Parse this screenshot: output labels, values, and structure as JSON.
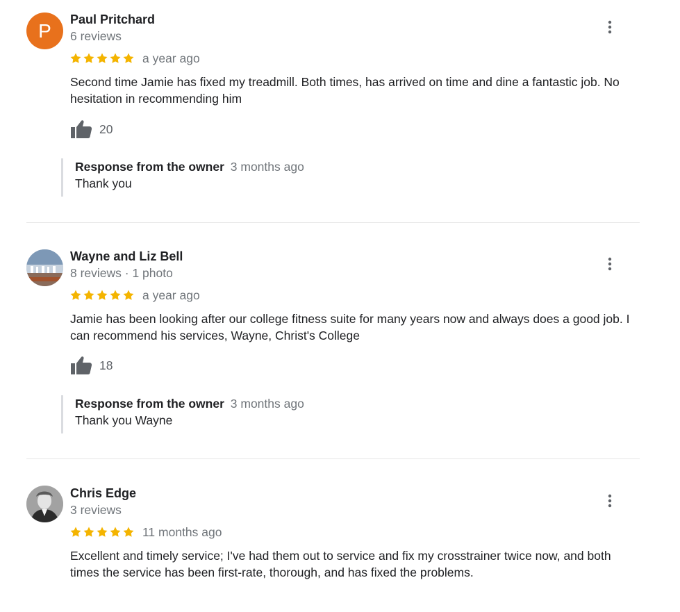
{
  "colors": {
    "star": "#f4b400",
    "avatar_p": "#e8711c",
    "muted": "#70757a",
    "text": "#202124",
    "divider": "#e6e6e6"
  },
  "reviews": [
    {
      "avatar_letter": "P",
      "avatar_icon": "letter-avatar",
      "name": "Paul Pritchard",
      "meta": "6 reviews",
      "rating": 5,
      "date": "a year ago",
      "text": "Second time Jamie has fixed my treadmill. Both times, has arrived on time and dine a fantastic job. No hesitation in recommending him",
      "likes": "20",
      "response_label": "Response from the owner",
      "response_date": "3 months ago",
      "response_text": "Thank you"
    },
    {
      "avatar_icon": "photo-avatar",
      "name": "Wayne and Liz Bell",
      "meta": "8 reviews · 1 photo",
      "rating": 5,
      "date": "a year ago",
      "text": "Jamie has been looking after our college fitness suite for many years now and always does a good job. I can recommend his services, Wayne, Christ's College",
      "likes": "18",
      "response_label": "Response from the owner",
      "response_date": "3 months ago",
      "response_text": "Thank you Wayne"
    },
    {
      "avatar_icon": "photo-avatar",
      "name": "Chris Edge",
      "meta": "3 reviews",
      "rating": 5,
      "date": "11 months ago",
      "text": "Excellent and timely service; I've had them out to service and fix my crosstrainer twice now, and both times the service has been first-rate, thorough, and has fixed the problems."
    }
  ]
}
